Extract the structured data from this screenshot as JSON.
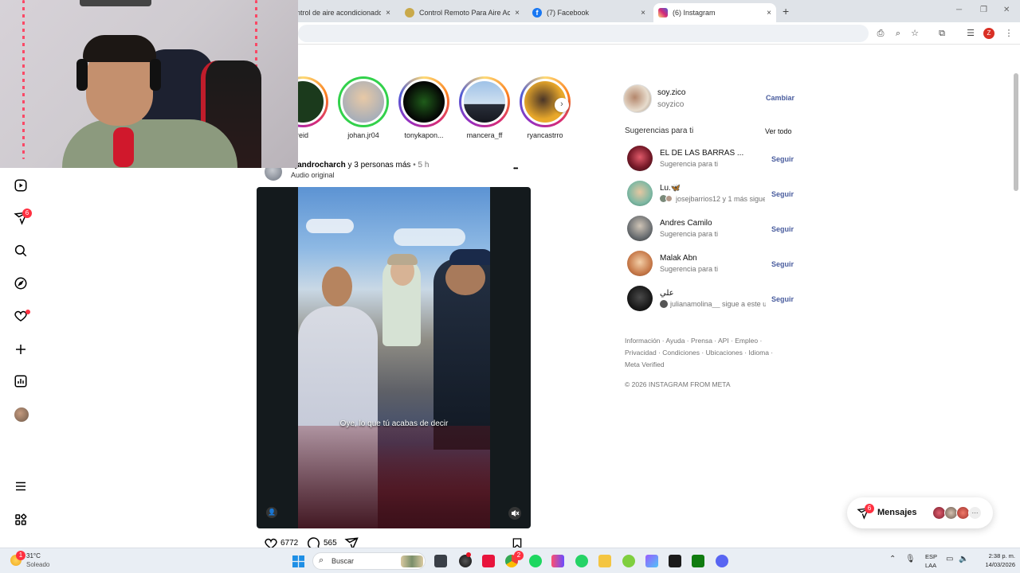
{
  "browser": {
    "tabs": [
      {
        "title": "ntrol de aire acondicionado",
        "close": "×",
        "favicon_color": "#6b6b6b"
      },
      {
        "title": "Control Remoto Para Aire Acon",
        "close": "×",
        "favicon_color": "#c9a94a"
      },
      {
        "title": "(7) Facebook",
        "close": "×",
        "favicon_color": "#1877f2"
      },
      {
        "title": "(6) Instagram",
        "close": "×",
        "favicon_color": "#d62976"
      }
    ],
    "new_tab": "+",
    "profile_initial": "Z"
  },
  "nav": {
    "messages_badge": "6"
  },
  "stories": [
    {
      "name": "reid"
    },
    {
      "name": "johan.jr04"
    },
    {
      "name": "tonykapon..."
    },
    {
      "name": "mancera_ff"
    },
    {
      "name": "ryancastrro"
    }
  ],
  "post": {
    "author": "lejandrocharch",
    "with_text": " y 3 personas más",
    "separator": " • ",
    "time": "5 h",
    "audio": "Audio original",
    "more": "•••",
    "caption": "Oye, lo que tú acabas de decir",
    "likes": "6772",
    "comments": "565"
  },
  "account": {
    "username": "soy.zico",
    "fullname": "soyzico",
    "switch": "Cambiar"
  },
  "suggestions": {
    "title": "Sugerencias para ti",
    "see_all": "Ver todo",
    "follow_label": "Seguir",
    "items": [
      {
        "name": "EL DE LAS BARRAS ...",
        "sub": "Sugerencia para ti",
        "color": "#7a1b2a"
      },
      {
        "name": "Lu.🦋",
        "sub": "josejbarrios12 y 1 más siguen",
        "color": "#7fb8a3"
      },
      {
        "name": "Andres Camilo",
        "sub": "Sugerencia para ti",
        "color": "#6b6f72"
      },
      {
        "name": "Malak Abn",
        "sub": "Sugerencia para ti",
        "color": "#c77a4a"
      },
      {
        "name": "علي",
        "sub": "julianamolina__ sigue a este us",
        "color": "#1a1a1a"
      }
    ]
  },
  "footer": {
    "line1": "Información · Ayuda · Prensa · API · Empleo ·",
    "line2": "Privacidad · Condiciones · Ubicaciones · Idioma ·",
    "line3": "Meta Verified",
    "copyright": "© 2026 INSTAGRAM FROM META"
  },
  "mensajes": {
    "label": "Mensajes",
    "badge": "6",
    "more": "···"
  },
  "taskbar": {
    "weather_temp": "31°C",
    "weather_desc": "Soleado",
    "weather_badge": "1",
    "search_placeholder": "Buscar",
    "lang1": "ESP",
    "lang2": "LAA",
    "time": "2:38 p. m.",
    "date": "14/03/2026",
    "chrome_badge": "2"
  }
}
